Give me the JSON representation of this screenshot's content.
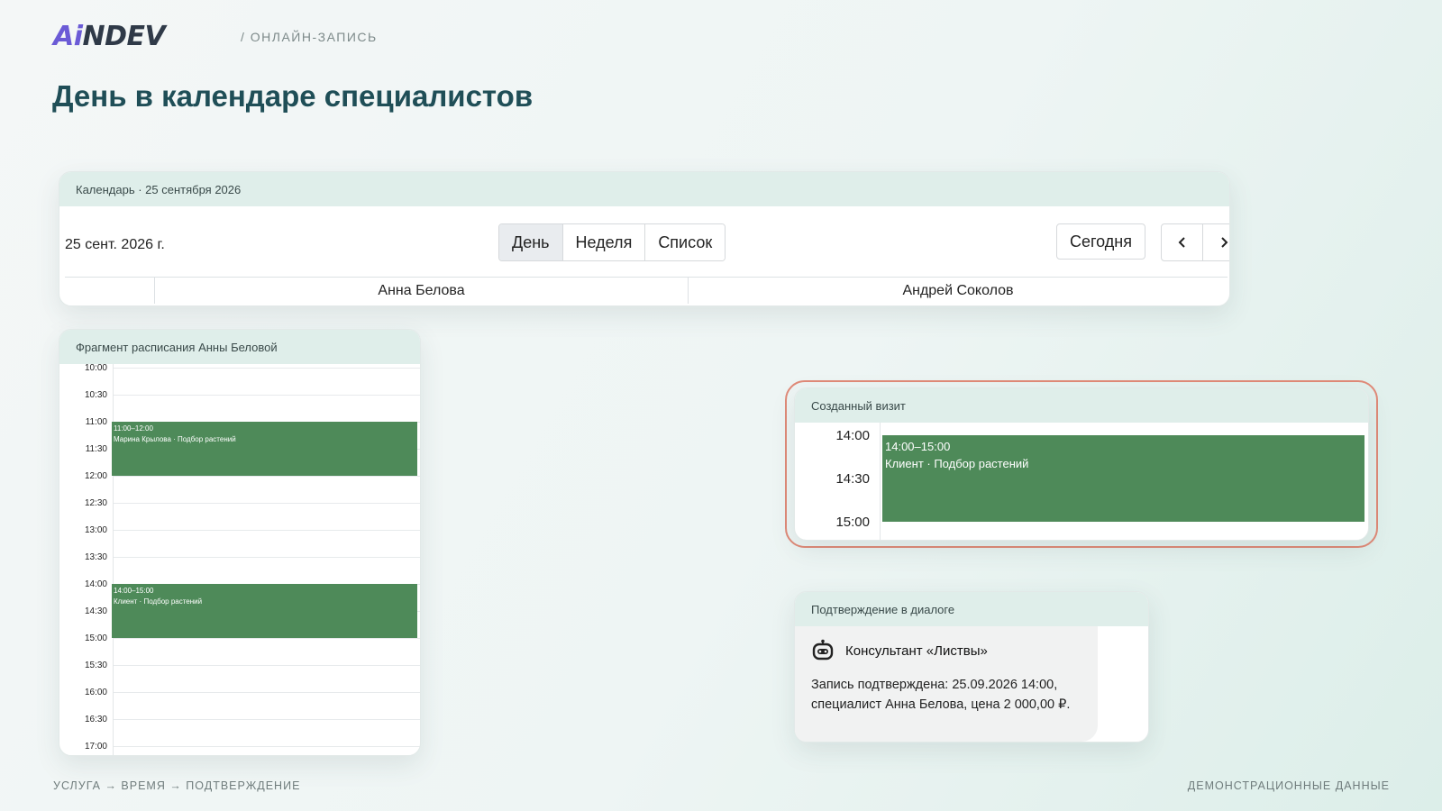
{
  "brand": {
    "logo_ai": "Ai",
    "logo_rest": "NDEV",
    "crumb": "/ ОНЛАЙН-ЗАПИСЬ"
  },
  "page_title": "День в календаре специалистов",
  "calendar": {
    "header": "Календарь · 25 сентября 2026",
    "date_label": "25 сент. 2026 г.",
    "views": [
      "День",
      "Неделя",
      "Список"
    ],
    "active_view": "День",
    "today_label": "Сегодня",
    "prev_icon": "chevron-left-icon",
    "next_icon": "chevron-right-icon",
    "resources": [
      "Анна Белова",
      "Андрей Соколов"
    ]
  },
  "schedule": {
    "header": "Фрагмент расписания Анны Беловой",
    "slots": [
      "10:00",
      "10:30",
      "11:00",
      "11:30",
      "12:00",
      "12:30",
      "13:00",
      "13:30",
      "14:00",
      "14:30",
      "15:00",
      "15:30",
      "16:00",
      "16:30",
      "17:00"
    ],
    "events": [
      {
        "time": "11:00–12:00",
        "title": "Марина Крылова · Подбор растений",
        "start": "11:00",
        "end": "12:00"
      },
      {
        "time": "14:00–15:00",
        "title": "Клиент · Подбор растений",
        "start": "14:00",
        "end": "15:00"
      }
    ],
    "event_color": "#4e8a59"
  },
  "visit": {
    "header": "Созданный визит",
    "slots": [
      "14:00",
      "14:30",
      "15:00"
    ],
    "event_time": "14:00–15:00",
    "event_title": "Клиент · Подбор растений",
    "highlight_color": "#e08a78"
  },
  "dialog": {
    "header": "Подтверждение в диалоге",
    "bot_icon": "robot-icon",
    "bot_name": "Консультант «Листвы»",
    "message": "Запись подтверждена: 25.09.2026 14:00, специалист Анна Белова, цена 2 000,00 ₽."
  },
  "footer": {
    "left": "УСЛУГА → ВРЕМЯ → ПОДТВЕРЖДЕНИЕ",
    "right": "ДЕМОНСТРАЦИОННЫЕ ДАННЫЕ"
  }
}
